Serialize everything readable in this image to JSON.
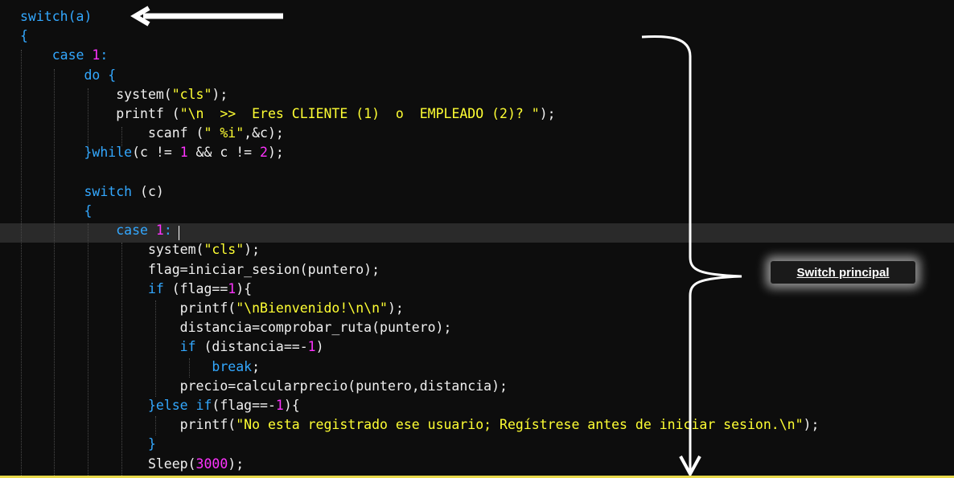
{
  "annotation": {
    "label": "Switch principal"
  },
  "code_lines": [
    {
      "tokens": [
        {
          "t": "switch",
          "c": "kw"
        },
        {
          "t": "(a)",
          "c": "kw"
        }
      ]
    },
    {
      "tokens": [
        {
          "t": "{",
          "c": "brace"
        }
      ]
    },
    {
      "tokens": [
        {
          "t": "    case ",
          "c": "kw"
        },
        {
          "t": "1",
          "c": "num"
        },
        {
          "t": ":",
          "c": "kw"
        }
      ]
    },
    {
      "tokens": [
        {
          "t": "        do ",
          "c": "kw"
        },
        {
          "t": "{",
          "c": "brace"
        }
      ]
    },
    {
      "tokens": [
        {
          "t": "            system(",
          "c": "fn"
        },
        {
          "t": "\"cls\"",
          "c": "str"
        },
        {
          "t": ");",
          "c": "fn"
        }
      ]
    },
    {
      "tokens": [
        {
          "t": "            printf (",
          "c": "fn"
        },
        {
          "t": "\"\\n  >>  Eres CLIENTE (1)  o  EMPLEADO (2)? \"",
          "c": "str"
        },
        {
          "t": ");",
          "c": "fn"
        }
      ]
    },
    {
      "tokens": [
        {
          "t": "                scanf (",
          "c": "fn"
        },
        {
          "t": "\" %i\"",
          "c": "str"
        },
        {
          "t": ",&c);",
          "c": "fn"
        }
      ]
    },
    {
      "tokens": [
        {
          "t": "        }while",
          "c": "kw"
        },
        {
          "t": "(c != ",
          "c": "fn"
        },
        {
          "t": "1",
          "c": "num"
        },
        {
          "t": " && c != ",
          "c": "fn"
        },
        {
          "t": "2",
          "c": "num"
        },
        {
          "t": ");",
          "c": "fn"
        }
      ]
    },
    {
      "tokens": [
        {
          "t": "",
          "c": "fn"
        }
      ]
    },
    {
      "tokens": [
        {
          "t": "        switch ",
          "c": "kw"
        },
        {
          "t": "(c)",
          "c": "fn"
        }
      ]
    },
    {
      "tokens": [
        {
          "t": "        {",
          "c": "brace"
        }
      ]
    },
    {
      "tokens": [
        {
          "t": "            case ",
          "c": "kw"
        },
        {
          "t": "1",
          "c": "num"
        },
        {
          "t": ":",
          "c": "kw"
        }
      ]
    },
    {
      "tokens": [
        {
          "t": "                system(",
          "c": "fn"
        },
        {
          "t": "\"cls\"",
          "c": "str"
        },
        {
          "t": ");",
          "c": "fn"
        }
      ]
    },
    {
      "tokens": [
        {
          "t": "                flag=iniciar_sesion(puntero);",
          "c": "fn"
        }
      ]
    },
    {
      "tokens": [
        {
          "t": "                if ",
          "c": "kw"
        },
        {
          "t": "(flag==",
          "c": "fn"
        },
        {
          "t": "1",
          "c": "num"
        },
        {
          "t": "){",
          "c": "fn"
        }
      ]
    },
    {
      "tokens": [
        {
          "t": "                    printf(",
          "c": "fn"
        },
        {
          "t": "\"\\nBienvenido!\\n\\n\"",
          "c": "str"
        },
        {
          "t": ");",
          "c": "fn"
        }
      ]
    },
    {
      "tokens": [
        {
          "t": "                    distancia=comprobar_ruta(puntero);",
          "c": "fn"
        }
      ]
    },
    {
      "tokens": [
        {
          "t": "                    if ",
          "c": "kw"
        },
        {
          "t": "(distancia==-",
          "c": "fn"
        },
        {
          "t": "1",
          "c": "num"
        },
        {
          "t": ")",
          "c": "fn"
        }
      ]
    },
    {
      "tokens": [
        {
          "t": "                        break",
          "c": "kw"
        },
        {
          "t": ";",
          "c": "fn"
        }
      ]
    },
    {
      "tokens": [
        {
          "t": "                    precio=calcularprecio(puntero,distancia);",
          "c": "fn"
        }
      ]
    },
    {
      "tokens": [
        {
          "t": "                }else if",
          "c": "kw"
        },
        {
          "t": "(flag==-",
          "c": "fn"
        },
        {
          "t": "1",
          "c": "num"
        },
        {
          "t": "){",
          "c": "fn"
        }
      ]
    },
    {
      "tokens": [
        {
          "t": "                    printf(",
          "c": "fn"
        },
        {
          "t": "\"No esta registrado ese usuario; Regístrese antes de iniciar sesion.\\n\"",
          "c": "str"
        },
        {
          "t": ");",
          "c": "fn"
        }
      ]
    },
    {
      "tokens": [
        {
          "t": "                }",
          "c": "brace"
        }
      ]
    },
    {
      "tokens": [
        {
          "t": "                Sleep(",
          "c": "fn"
        },
        {
          "t": "3000",
          "c": "num"
        },
        {
          "t": ");",
          "c": "fn"
        }
      ]
    }
  ],
  "colors": {
    "background": "#0d0d0d",
    "keyword": "#33a8ff",
    "string": "#ffff33",
    "number": "#ff33ff",
    "text": "#f0f0f0",
    "current_line": "#2a2a2a"
  },
  "icons": [
    "left-arrow-icon",
    "down-arrow-icon",
    "curly-brace-icon"
  ]
}
